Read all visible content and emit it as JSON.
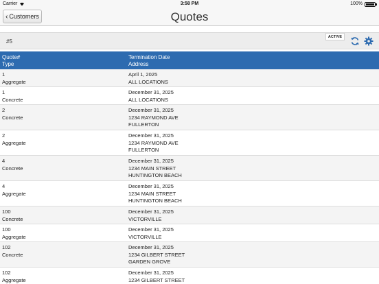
{
  "status_bar": {
    "carrier": "Carrier",
    "time": "3:58 PM",
    "battery": "100%"
  },
  "nav": {
    "back_label": "Customers",
    "title": "Quotes"
  },
  "filter": {
    "customer": "#5",
    "status": "ACTIVE"
  },
  "table": {
    "header": {
      "col1_line1": "Quote#",
      "col1_line2": "Type",
      "col2_line1": "Termination Date",
      "col2_line2": "Address"
    },
    "rows": [
      {
        "quote": "1",
        "type": "Aggregate",
        "date": "April 1, 2025",
        "address1": "ALL LOCATIONS",
        "address2": ""
      },
      {
        "quote": "1",
        "type": "Concrete",
        "date": "December 31, 2025",
        "address1": "ALL LOCATIONS",
        "address2": ""
      },
      {
        "quote": "2",
        "type": "Concrete",
        "date": "December 31, 2025",
        "address1": "1234 RAYMOND AVE",
        "address2": "FULLERTON"
      },
      {
        "quote": "2",
        "type": "Aggregate",
        "date": "December 31, 2025",
        "address1": "1234 RAYMOND AVE",
        "address2": "FULLERTON"
      },
      {
        "quote": "4",
        "type": "Concrete",
        "date": "December 31, 2025",
        "address1": "1234 MAIN STREET",
        "address2": "HUNTINGTON BEACH"
      },
      {
        "quote": "4",
        "type": "Aggregate",
        "date": "December 31, 2025",
        "address1": "1234 MAIN STREET",
        "address2": "HUNTINGTON BEACH"
      },
      {
        "quote": "100",
        "type": "Concrete",
        "date": "December 31, 2025",
        "address1": "VICTORVILLE",
        "address2": ""
      },
      {
        "quote": "100",
        "type": "Aggregate",
        "date": "December 31, 2025",
        "address1": "VICTORVILLE",
        "address2": ""
      },
      {
        "quote": "102",
        "type": "Concrete",
        "date": "December 31, 2025",
        "address1": "1234 GILBERT STREET",
        "address2": "GARDEN GROVE"
      },
      {
        "quote": "102",
        "type": "Aggregate",
        "date": "December 31, 2025",
        "address1": "1234 GILBERT STREET",
        "address2": ""
      }
    ]
  },
  "icons": {
    "back": "chevron-left-icon",
    "refresh": "refresh-icon",
    "settings": "gear-icon"
  },
  "colors": {
    "header_bg": "#2d6bb0",
    "icon_blue": "#2d6bb0"
  }
}
